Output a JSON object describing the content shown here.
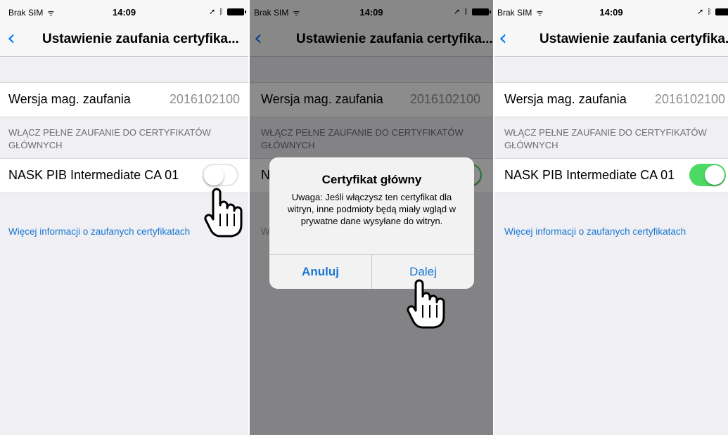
{
  "status_bar": {
    "carrier": "Brak SIM",
    "wifi": "ᯤ",
    "time": "14:09",
    "location": "➚",
    "bluetooth": "ᛒ"
  },
  "nav": {
    "back": "‹",
    "title": "Ustawienie zaufania certyfika..."
  },
  "trust_store": {
    "label": "Wersja mag. zaufania",
    "value": "2016102100"
  },
  "section_header": "WŁĄCZ PEŁNE ZAUFANIE DO CERTYFIKATÓW GŁÓWNYCH",
  "certificate": {
    "name": "NASK PIB Intermediate CA 01",
    "name_partial": "N",
    "screen1_enabled": false,
    "screen3_enabled": true
  },
  "more_info_link": "Więcej informacji o zaufanych certyfikatach",
  "more_info_partial": "W",
  "alert": {
    "title": "Certyfikat główny",
    "message": "Uwaga: Jeśli włączysz ten certyfikat dla witryn, inne podmioty będą miały wgląd w prywatne dane wysyłane do witryn.",
    "cancel": "Anuluj",
    "confirm": "Dalej"
  },
  "colors": {
    "ios_blue": "#007aff",
    "link_blue": "#1a76d2",
    "toggle_on_green": "#4cd964",
    "background": "#efeff4"
  },
  "icons": [
    "wifi-icon",
    "location-arrow-icon",
    "bluetooth-icon",
    "battery-icon",
    "back-chevron-icon",
    "hand-pointer-cursor-icon"
  ]
}
